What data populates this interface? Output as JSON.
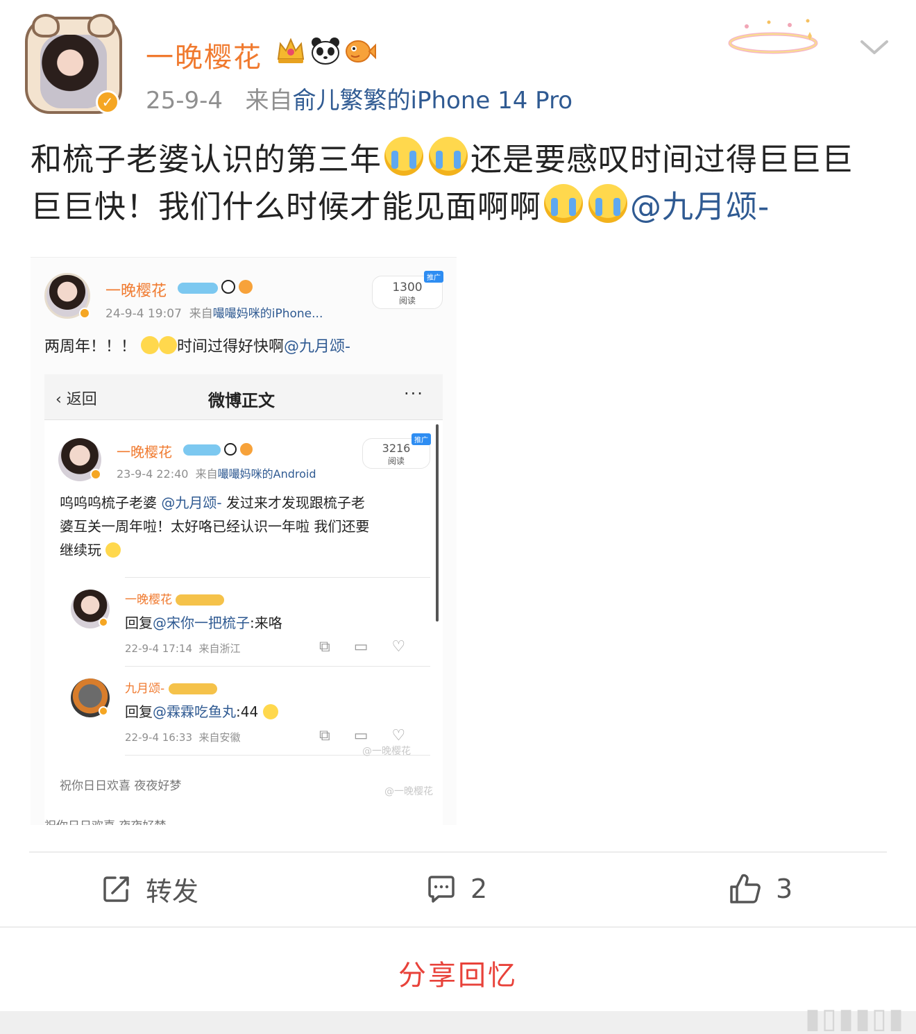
{
  "header": {
    "user_name": "一晚樱花",
    "badges": [
      "crown-icon",
      "panda-icon",
      "pufferfish-icon"
    ],
    "date": "25-9-4",
    "source_prefix": "来自",
    "source": "俞儿繁繁的iPhone 14 Pro"
  },
  "post": {
    "line1_a": "和梳子老婆认识的第三年",
    "line1_b": "还是要感叹时间过得巨巨巨",
    "line2_a": "巨巨快！我们什么时候才能见面啊啊",
    "mention": "@九月颂-"
  },
  "embedded": {
    "outer": {
      "user_name": "一晚樱花",
      "time": "24-9-4 19:07",
      "source_prefix": "来自",
      "source": "嘬嘬妈咪的iPhone...",
      "read_count": "1300",
      "read_label": "阅读",
      "promo": "推广",
      "text": "两周年！！！",
      "text_after": "时间过得好快啊",
      "mention": "@九月颂-"
    },
    "navbar": {
      "back": "返回",
      "title": "微博正文",
      "more": "···"
    },
    "inner": {
      "user_name": "一晚樱花",
      "time": "23-9-4 22:40",
      "source_prefix": "来自",
      "source": "嘬嘬妈咪的Android",
      "read_count": "3216",
      "read_label": "阅读",
      "promo": "推广",
      "text_l1a": "呜呜呜梳子老婆",
      "mention": "@九月颂-",
      "text_l1b": "发过来才发现跟梳子老",
      "text_l2": "婆互关一周年啦！太好咯已经认识一年啦 我们还要",
      "text_l3": "继续玩"
    },
    "comments": [
      {
        "name": "一晚樱花",
        "reply_prefix": "回复",
        "reply_to": "@宋你一把梳子",
        "reply_text": ":来咯",
        "time": "22-9-4 17:14",
        "location": "来自浙江"
      },
      {
        "name": "九月颂-",
        "reply_prefix": "回复",
        "reply_to": "@霖霖吃鱼丸",
        "reply_text": ":44",
        "time": "22-9-4 16:33",
        "location": "来自安徽"
      }
    ],
    "footer1": "祝你日日欢喜  夜夜好梦",
    "footer2": "祝你日日欢喜  夜夜好梦",
    "watermark": "@一晚樱花"
  },
  "actions": {
    "repost_label": "转发",
    "comment_count": "2",
    "like_count": "3"
  },
  "share_label": "分享回忆",
  "colors": {
    "name": "#f07a2f",
    "link": "#2f5a92",
    "share": "#e8423a",
    "meta": "#8f8f8f"
  }
}
